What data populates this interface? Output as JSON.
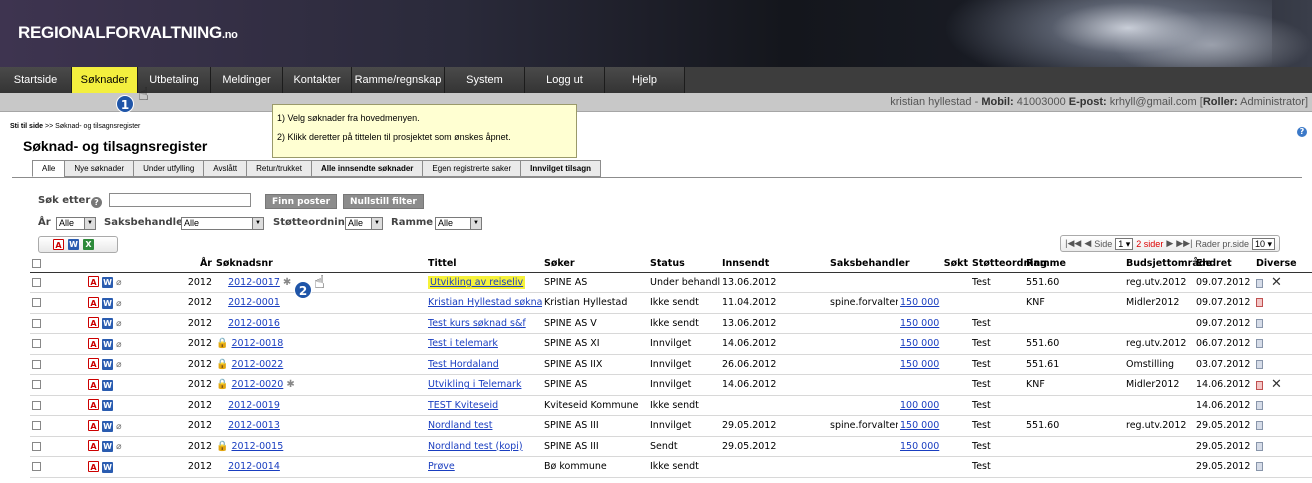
{
  "app": {
    "brand": "REGIONALFORVALTNING",
    "brand_suffix": ".no"
  },
  "menu": [
    "Startside",
    "Søknader",
    "Utbetaling",
    "Meldinger",
    "Kontakter",
    "Ramme/regnskap",
    "System",
    "Logg ut",
    "Hjelp"
  ],
  "menu_active": "Søknader",
  "user": {
    "name": "kristian hyllestad",
    "mobil_label": "Mobil:",
    "mobil": "41003000",
    "epost_label": "E-post:",
    "epost": "krhyll@gmail.com",
    "roller_label": "Roller:",
    "roller": "Administrator"
  },
  "tooltip": {
    "line1": "1) Velg søknader fra hovedmenyen.",
    "line2": "2) Klikk deretter på tittelen til prosjektet som ønskes åpnet."
  },
  "callouts": {
    "one": "1",
    "two": "2"
  },
  "breadcrumb": {
    "label": "Sti til side",
    "sep": ">>",
    "path": "Søknad- og tilsagnsregister"
  },
  "page_title": "Søknad- og tilsagnsregister",
  "tabs": [
    {
      "label": "Alle",
      "bold": false
    },
    {
      "label": "Nye søknader",
      "bold": false
    },
    {
      "label": "Under utfylling",
      "bold": false
    },
    {
      "label": "Avslått",
      "bold": false
    },
    {
      "label": "Retur/trukket",
      "bold": false
    },
    {
      "label": "Alle innsendte søknader",
      "bold": true
    },
    {
      "label": "Egen registrerte saker",
      "bold": false
    },
    {
      "label": "Innvilget tilsagn",
      "bold": true
    }
  ],
  "filters": {
    "search_label": "Søk etter",
    "find_button": "Finn poster",
    "reset_button": "Nullstill filter",
    "year_label": "År",
    "year_value": "Alle",
    "handler_label": "Saksbehandler",
    "handler_value": "Alle",
    "scheme_label": "Støtteordning",
    "scheme_value": "Alle",
    "frame_label": "Ramme",
    "frame_value": "Alle"
  },
  "pager": {
    "side_label": "Side",
    "page": "1",
    "pages_text": "2 sider",
    "rows_label": "Rader pr.side",
    "rows_value": "10"
  },
  "columns": [
    "År",
    "Søknadsnr",
    "Tittel",
    "Søker",
    "Status",
    "Innsendt",
    "Saksbehandler",
    "Søkt",
    "Støtteordning",
    "Ramme",
    "Budsjettområde",
    "Endret",
    "Diverse"
  ],
  "rows": [
    {
      "ar": "2012",
      "nr": "2012-0017",
      "lock": false,
      "star": true,
      "pdf": true,
      "word": true,
      "clip": true,
      "tittel": "Utvikling av reiseliv",
      "soker": "SPINE AS",
      "status": "Under behandling",
      "innsendt": "13.06.2012",
      "saksbehandler": "",
      "sokt": "",
      "stotte": "Test",
      "ramme": "551.60",
      "budsjett": "reg.utv.2012",
      "endret": "09.07.2012",
      "doc": "normal",
      "x": true
    },
    {
      "ar": "2012",
      "nr": "2012-0001",
      "lock": false,
      "star": false,
      "pdf": true,
      "word": true,
      "clip": true,
      "tittel": "Kristian Hyllestad søknad (kopi)",
      "soker": "Kristian Hyllestad",
      "status": "Ikke sendt",
      "innsendt": "11.04.2012",
      "saksbehandler": "spine.forvalter",
      "sokt": "150 000",
      "stotte": "",
      "ramme": "KNF",
      "budsjett": "Midler2012",
      "endret": "09.07.2012",
      "doc": "red",
      "x": false
    },
    {
      "ar": "2012",
      "nr": "2012-0016",
      "lock": false,
      "star": false,
      "pdf": true,
      "word": true,
      "clip": true,
      "tittel": "Test kurs søknad s&f",
      "soker": "SPINE AS V",
      "status": "Ikke sendt",
      "innsendt": "13.06.2012",
      "saksbehandler": "",
      "sokt": "150 000",
      "stotte": "Test",
      "ramme": "",
      "budsjett": "",
      "endret": "09.07.2012",
      "doc": "normal",
      "x": false
    },
    {
      "ar": "2012",
      "nr": "2012-0018",
      "lock": true,
      "star": false,
      "pdf": true,
      "word": true,
      "clip": true,
      "tittel": "Test i telemark",
      "soker": "SPINE AS XI",
      "status": "Innvilget",
      "innsendt": "14.06.2012",
      "saksbehandler": "",
      "sokt": "150 000",
      "stotte": "Test",
      "ramme": "551.60",
      "budsjett": "reg.utv.2012",
      "endret": "06.07.2012",
      "doc": "normal",
      "x": false
    },
    {
      "ar": "2012",
      "nr": "2012-0022",
      "lock": true,
      "star": false,
      "pdf": true,
      "word": true,
      "clip": true,
      "tittel": "Test Hordaland",
      "soker": "SPINE AS IIX",
      "status": "Innvilget",
      "innsendt": "26.06.2012",
      "saksbehandler": "",
      "sokt": "150 000",
      "stotte": "Test",
      "ramme": "551.61",
      "budsjett": "Omstilling",
      "endret": "03.07.2012",
      "doc": "normal",
      "x": false
    },
    {
      "ar": "2012",
      "nr": "2012-0020",
      "lock": true,
      "star": true,
      "pdf": true,
      "word": true,
      "clip": false,
      "tittel": "Utvikling i Telemark",
      "soker": "SPINE AS",
      "status": "Innvilget",
      "innsendt": "14.06.2012",
      "saksbehandler": "",
      "sokt": "",
      "stotte": "Test",
      "ramme": "KNF",
      "budsjett": "Midler2012",
      "endret": "14.06.2012",
      "doc": "red",
      "x": true
    },
    {
      "ar": "2012",
      "nr": "2012-0019",
      "lock": false,
      "star": false,
      "pdf": true,
      "word": true,
      "clip": false,
      "tittel": "TEST Kviteseid",
      "soker": "Kviteseid Kommune",
      "status": "Ikke sendt",
      "innsendt": "",
      "saksbehandler": "",
      "sokt": "100 000",
      "stotte": "Test",
      "ramme": "",
      "budsjett": "",
      "endret": "14.06.2012",
      "doc": "normal",
      "x": false
    },
    {
      "ar": "2012",
      "nr": "2012-0013",
      "lock": false,
      "star": false,
      "pdf": true,
      "word": true,
      "clip": true,
      "tittel": "Nordland test",
      "soker": "SPINE AS III",
      "status": "Innvilget",
      "innsendt": "29.05.2012",
      "saksbehandler": "spine.forvalter",
      "sokt": "150 000",
      "stotte": "Test",
      "ramme": "551.60",
      "budsjett": "reg.utv.2012",
      "endret": "29.05.2012",
      "doc": "normal",
      "x": false
    },
    {
      "ar": "2012",
      "nr": "2012-0015",
      "lock": true,
      "star": false,
      "pdf": true,
      "word": true,
      "clip": true,
      "tittel": "Nordland test (kopi)",
      "soker": "SPINE AS III",
      "status": "Sendt",
      "innsendt": "29.05.2012",
      "saksbehandler": "",
      "sokt": "150 000",
      "stotte": "Test",
      "ramme": "",
      "budsjett": "",
      "endret": "29.05.2012",
      "doc": "normal",
      "x": false
    },
    {
      "ar": "2012",
      "nr": "2012-0014",
      "lock": false,
      "star": false,
      "pdf": true,
      "word": true,
      "clip": false,
      "tittel": "Prøve",
      "soker": "Bø kommune",
      "status": "Ikke sendt",
      "innsendt": "",
      "saksbehandler": "",
      "sokt": "",
      "stotte": "Test",
      "ramme": "",
      "budsjett": "",
      "endret": "29.05.2012",
      "doc": "normal",
      "x": false
    }
  ]
}
